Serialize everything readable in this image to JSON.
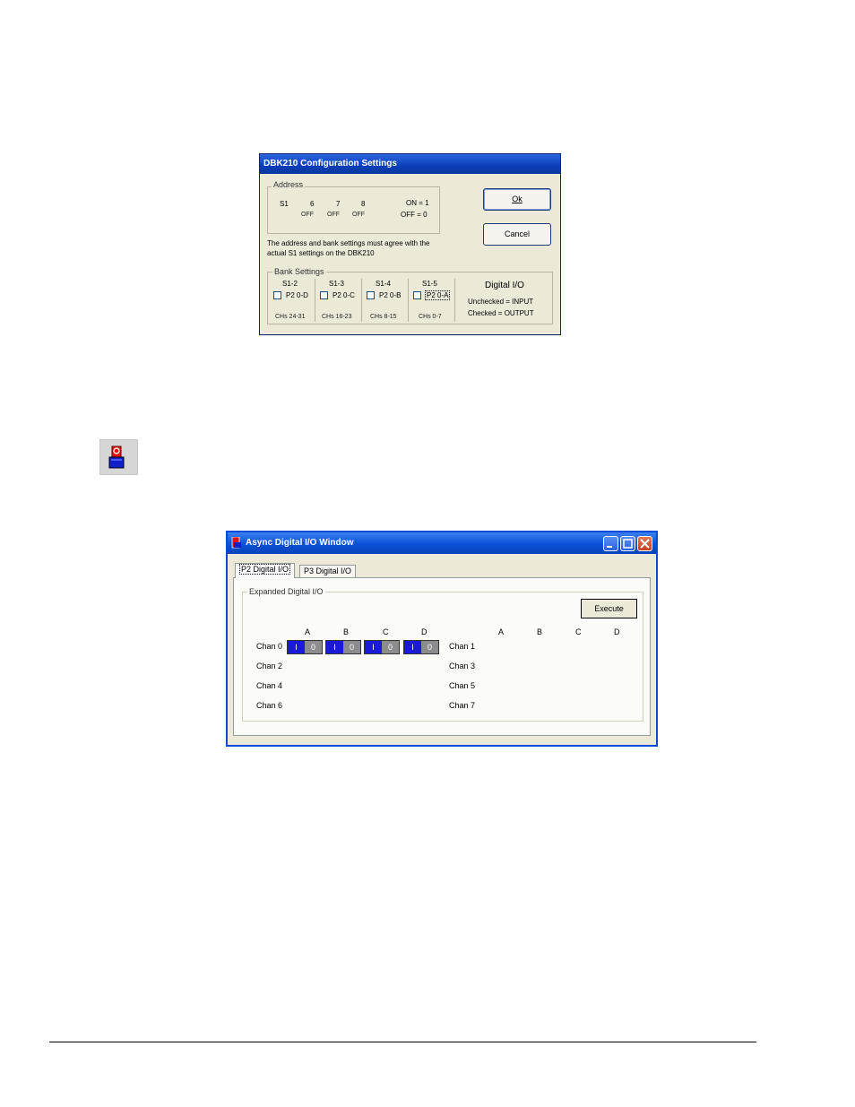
{
  "config_dialog": {
    "title": "DBK210 Configuration Settings",
    "address": {
      "group_label": "Address",
      "switch_label": "S1",
      "bits": [
        "6",
        "7",
        "8"
      ],
      "states": [
        "OFF",
        "OFF",
        "OFF"
      ],
      "legend_on": "ON = 1",
      "legend_off": "OFF = 0"
    },
    "ok_label": "Ok",
    "cancel_label": "Cancel",
    "note": "The address and bank settings must agree with the actual S1 settings on the DBK210",
    "bank": {
      "group_label": "Bank Settings",
      "banks": [
        {
          "switch": "S1-2",
          "port": "P2 0-D",
          "channels": "CHs 24-31",
          "checked": false
        },
        {
          "switch": "S1-3",
          "port": "P2 0-C",
          "channels": "CHs 16-23",
          "checked": false
        },
        {
          "switch": "S1-4",
          "port": "P2 0-B",
          "channels": "CHs 8-15",
          "checked": false
        },
        {
          "switch": "S1-5",
          "port": "P2 0-A",
          "channels": "CHs 0-7",
          "checked": false
        }
      ],
      "dio_title": "Digital I/O",
      "dio_unchecked": "Unchecked = INPUT",
      "dio_checked": "Checked = OUTPUT"
    }
  },
  "toolbar_icon": {
    "icon": "async-digital-io-icon"
  },
  "async_window": {
    "title": "Async Digital I/O Window",
    "tabs": [
      "P2 Digital I/O",
      "P3 Digital I/O"
    ],
    "active_tab": 0,
    "group_label": "Expanded Digital I/O",
    "execute_label": "Execute",
    "columns": [
      "A",
      "B",
      "C",
      "D"
    ],
    "left_channels": [
      "Chan 0",
      "Chan 2",
      "Chan 4",
      "Chan 6"
    ],
    "right_channels": [
      "Chan 1",
      "Chan 3",
      "Chan 5",
      "Chan 7"
    ],
    "toggle_on_label": "I",
    "toggle_off_label": "0",
    "caption_buttons": [
      "minimize-icon",
      "maximize-icon",
      "close-icon"
    ]
  }
}
